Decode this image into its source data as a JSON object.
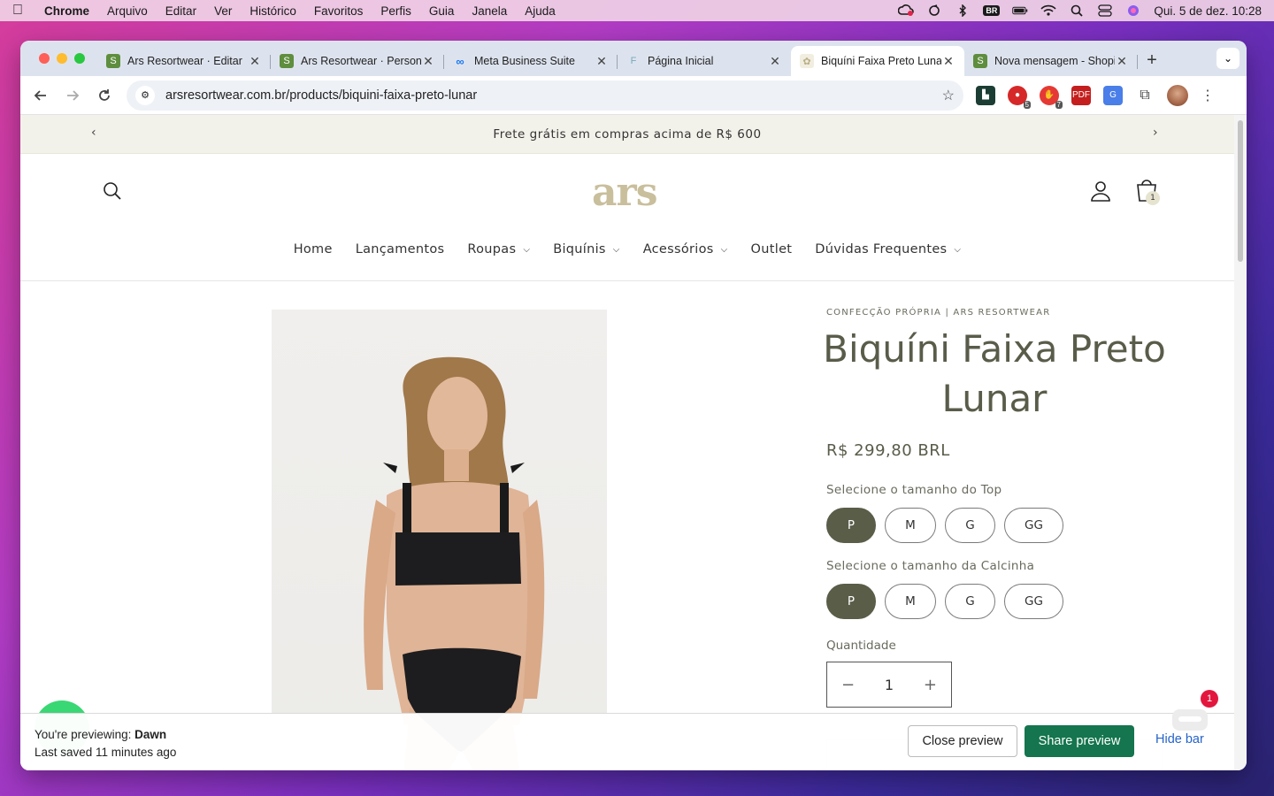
{
  "menubar": {
    "app": "Chrome",
    "items": [
      "Arquivo",
      "Editar",
      "Ver",
      "Histórico",
      "Favoritos",
      "Perfis",
      "Guia",
      "Janela",
      "Ajuda"
    ],
    "keyboard_badge": "BR",
    "clock": "Qui. 5 de dez.  10:28"
  },
  "browser": {
    "tabs": [
      {
        "title": "Ars Resortwear · Editar",
        "favicon": "shopify-icon",
        "active": false
      },
      {
        "title": "Ars Resortwear · Personalizar",
        "favicon": "shopify-icon",
        "active": false
      },
      {
        "title": "Meta Business Suite",
        "favicon": "meta-icon",
        "active": false
      },
      {
        "title": "Página Inicial",
        "favicon": "page-icon",
        "active": false
      },
      {
        "title": "Biquíni Faixa Preto Lunar",
        "favicon": "ars-icon",
        "active": true
      },
      {
        "title": "Nova mensagem - Shopify",
        "favicon": "shopify-icon",
        "active": false
      }
    ],
    "url": "arsresortwear.com.br/products/biquini-faixa-preto-lunar",
    "extension_badges": [
      "5",
      "7"
    ]
  },
  "store": {
    "announcement": "Frete grátis em compras acima de R$ 600",
    "logo": "ars",
    "cart_count": "1",
    "nav": [
      {
        "label": "Home",
        "dropdown": false
      },
      {
        "label": "Lançamentos",
        "dropdown": false
      },
      {
        "label": "Roupas",
        "dropdown": true
      },
      {
        "label": "Biquínis",
        "dropdown": true
      },
      {
        "label": "Acessórios",
        "dropdown": true
      },
      {
        "label": "Outlet",
        "dropdown": false
      },
      {
        "label": "Dúvidas Frequentes",
        "dropdown": true
      }
    ]
  },
  "product": {
    "vendor": "CONFECÇÃO PRÓPRIA | ARS RESORTWEAR",
    "title": "Biquíni Faixa Preto Lunar",
    "price": "R$ 299,80 BRL",
    "top_label": "Selecione o tamanho do Top",
    "top_sizes": [
      "P",
      "M",
      "G",
      "GG"
    ],
    "top_selected": "P",
    "bottom_label": "Selecione o tamanho da Calcinha",
    "bottom_sizes": [
      "P",
      "M",
      "G",
      "GG"
    ],
    "bottom_selected": "P",
    "quantity_label": "Quantidade",
    "quantity": "1"
  },
  "preview_bar": {
    "previewing_prefix": "You're previewing: ",
    "theme": "Dawn",
    "last_saved": "Last saved 11 minutes ago",
    "close_label": "Close preview",
    "share_label": "Share preview",
    "hide_label": "Hide bar"
  },
  "chat_badge": "1",
  "colors": {
    "accent": "#5a5d48",
    "share_button": "#14754e",
    "link": "#2563c9",
    "announcement_bg": "#f3f2ea"
  }
}
